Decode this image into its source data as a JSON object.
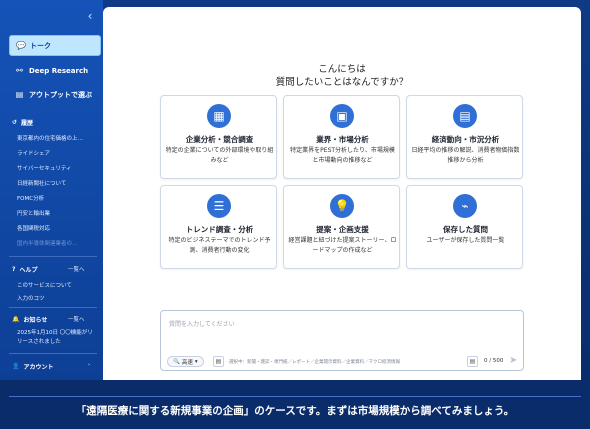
{
  "sidebar": {
    "nav": [
      {
        "label": "トーク",
        "icon": "chat-icon"
      },
      {
        "label": "Deep Research",
        "icon": "research-icon"
      },
      {
        "label": "アウトプットで選ぶ",
        "icon": "document-icon"
      }
    ],
    "history_label": "履歴",
    "history": [
      "東京都内の住宅価格の上…",
      "ライドシェア",
      "サイバーセキュリティ",
      "日経新聞社について",
      "FOMC分析",
      "円安と輸出業",
      "各国関税対応",
      "国内半導体関連業者の…"
    ],
    "help": {
      "label": "ヘルプ",
      "more": "一覧へ",
      "items": [
        "このサービスについて",
        "入力のコツ"
      ]
    },
    "news": {
      "label": "お知らせ",
      "more": "一覧へ",
      "text": "2025年1月10日 〇〇機能がリリースされました"
    },
    "account": {
      "label": "アカウント"
    }
  },
  "main": {
    "greeting_line1": "こんにちは",
    "greeting_line2": "質問したいことはなんですか？",
    "cards": [
      {
        "title": "企業分析・競合調査",
        "desc": "特定の企業についての外部環境や取り組みなど",
        "icon": "building-icon"
      },
      {
        "title": "業界・市場分析",
        "desc": "特定業界をPEST分析したり、市場規模と市場動向の推移など",
        "icon": "briefcase-icon"
      },
      {
        "title": "経済動向・市況分析",
        "desc": "日経平均の推移の解説、消費者物価指数推移から分析",
        "icon": "newspaper-icon"
      },
      {
        "title": "トレンド調査・分析",
        "desc": "特定のビジネステーマでのトレンド予測、消費者行動の変化",
        "icon": "book-icon"
      },
      {
        "title": "提案・企画支援",
        "desc": "経営課題と紐づけた提案ストーリー、ロードマップの作成など",
        "icon": "lightbulb-icon"
      },
      {
        "title": "保存した質問",
        "desc": "ユーザーが保存した質問一覧",
        "icon": "clip-icon"
      }
    ],
    "input": {
      "placeholder": "質問を入力してください",
      "model": "高速",
      "hint": "選択中：新聞・雑誌・専門紙／レポート／企業開示資料／企業資料／マクロ経済情報",
      "counter": "0 / 500"
    }
  },
  "caption": "「遠隔医療に関する新規事業の企画」のケースです。まずは市場規模から調べてみましょう。",
  "colors": {
    "sidebar": "#1553b8",
    "accent": "#2f6fd6",
    "caption_bg": "#0a2c6a"
  }
}
